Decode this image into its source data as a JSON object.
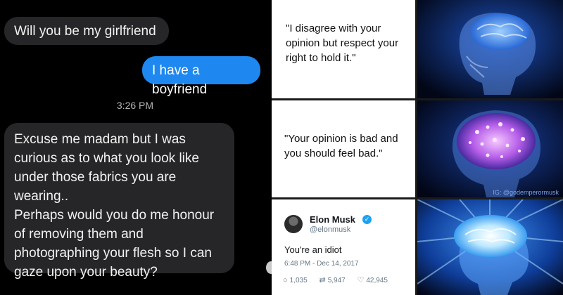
{
  "chat": {
    "msg1": "Will you be my girlfriend",
    "msg2": "I have a boyfriend",
    "timestamp": "3:26 PM",
    "msg3_lines": [
      "Excuse me madam but I was",
      "curious as to what you look like",
      "under those fabrics you are",
      "wearing..",
      "Perhaps would you do me honour",
      "of removing them and",
      "photographing your flesh so I can",
      "gaze upon your beauty?"
    ],
    "colors": {
      "incoming": "#262628",
      "outgoing": "#1e88f0"
    }
  },
  "meme": {
    "panel1_text": "\"I disagree with your opinion but respect your right to hold it.\"",
    "panel2_text": "\"Your opinion is bad and you should feel bad.\"",
    "watermark": "IG: @godemperormusk",
    "tweet": {
      "name": "Elon Musk",
      "handle": "@elonmusk",
      "text": "You're an idiot",
      "time": "6:48 PM - Dec 14, 2017",
      "replies": "1,035",
      "retweets": "5,947",
      "likes": "42,945",
      "icons": [
        "reply-icon",
        "retweet-icon",
        "like-icon",
        "verified-icon"
      ]
    }
  }
}
